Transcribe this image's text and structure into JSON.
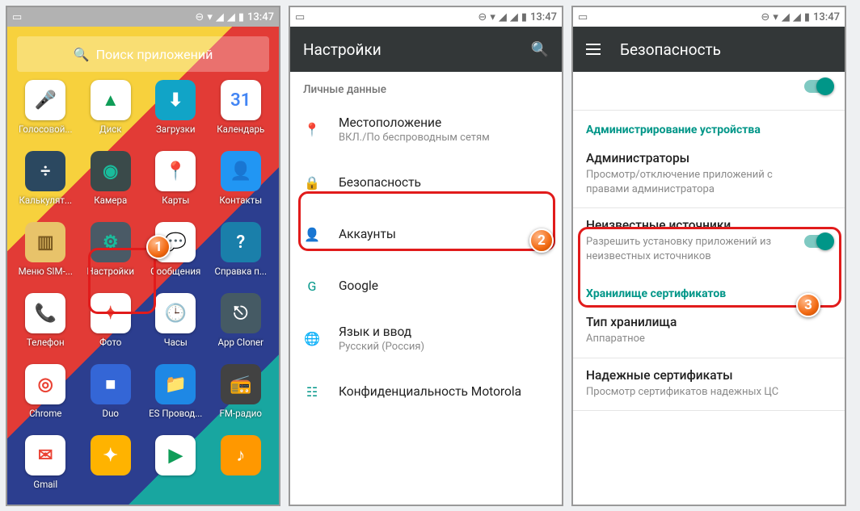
{
  "status": {
    "time": "13:47"
  },
  "drawer": {
    "search_placeholder": "Поиск приложений",
    "apps": [
      {
        "label": "Голосовой...",
        "bg": "#ffffff",
        "glyph": "🎤",
        "fg": "#4285f4"
      },
      {
        "label": "Диск",
        "bg": "#ffffff",
        "glyph": "▲",
        "fg": "#0f9d58"
      },
      {
        "label": "Загрузки",
        "bg": "#11a4c7",
        "glyph": "⬇",
        "fg": "#fff"
      },
      {
        "label": "Календарь",
        "bg": "#ffffff",
        "glyph": "31",
        "fg": "#4285f4"
      },
      {
        "label": "Калькулят...",
        "bg": "#2b4860",
        "glyph": "÷",
        "fg": "#fff"
      },
      {
        "label": "Камера",
        "bg": "#3a4a4a",
        "glyph": "◉",
        "fg": "#1abc9c"
      },
      {
        "label": "Карты",
        "bg": "#ffffff",
        "glyph": "📍",
        "fg": "#ea4335"
      },
      {
        "label": "Контакты",
        "bg": "#2196f3",
        "glyph": "👤",
        "fg": "#fff"
      },
      {
        "label": "Меню SIM-...",
        "bg": "#e8c36a",
        "glyph": "▥",
        "fg": "#7a5a20"
      },
      {
        "label": "Настройки",
        "bg": "#4a5a66",
        "glyph": "⚙",
        "fg": "#1abc9c"
      },
      {
        "label": "Сообщения",
        "bg": "#ffffff",
        "glyph": "💬",
        "fg": "#2196f3"
      },
      {
        "label": "Справка п...",
        "bg": "#1a7faa",
        "glyph": "?",
        "fg": "#fff"
      },
      {
        "label": "Телефон",
        "bg": "#ffffff",
        "glyph": "📞",
        "fg": "#2196f3"
      },
      {
        "label": "Фото",
        "bg": "#ffffff",
        "glyph": "✦",
        "fg": "#ea4335"
      },
      {
        "label": "Часы",
        "bg": "#ffffff",
        "glyph": "🕒",
        "fg": "#2196f3"
      },
      {
        "label": "App Cloner",
        "bg": "#455a64",
        "glyph": "⎋",
        "fg": "#fff"
      },
      {
        "label": "Chrome",
        "bg": "#ffffff",
        "glyph": "◎",
        "fg": "#ea4335"
      },
      {
        "label": "Duo",
        "bg": "#3466d6",
        "glyph": "■",
        "fg": "#fff"
      },
      {
        "label": "ES Провод...",
        "bg": "#1e88e5",
        "glyph": "📁",
        "fg": "#fff"
      },
      {
        "label": "FM-радио",
        "bg": "#424242",
        "glyph": "📻",
        "fg": "#ff9800"
      },
      {
        "label": "Gmail",
        "bg": "#ffffff",
        "glyph": "✉",
        "fg": "#ea4335"
      },
      {
        "label": "",
        "bg": "#ffb300",
        "glyph": "✦",
        "fg": "#fff"
      },
      {
        "label": "",
        "bg": "#ffffff",
        "glyph": "▶",
        "fg": "#0f9d58"
      },
      {
        "label": "",
        "bg": "#ff9800",
        "glyph": "♪",
        "fg": "#fff"
      }
    ]
  },
  "settings": {
    "title": "Настройки",
    "section": "Личные данные",
    "items": [
      {
        "title": "Местоположение",
        "sub": "ВКЛ./По беспроводным сетям",
        "icon": "📍"
      },
      {
        "title": "Безопасность",
        "sub": "",
        "icon": "🔒"
      },
      {
        "title": "Аккаунты",
        "sub": "",
        "icon": "👤"
      },
      {
        "title": "Google",
        "sub": "",
        "icon": "G"
      },
      {
        "title": "Язык и ввод",
        "sub": "Русский (Россия)",
        "icon": "🌐"
      },
      {
        "title": "Конфиденциальность Motorola",
        "sub": "",
        "icon": "☷"
      }
    ]
  },
  "security": {
    "title": "Безопасность",
    "section_admin": "Администрирование устройства",
    "admins": {
      "title": "Администраторы",
      "sub": "Просмотр/отключение приложений с правами администратора"
    },
    "unknown": {
      "title": "Неизвестные источники",
      "sub": "Разрешить установку приложений из неизвестных источников"
    },
    "section_cert": "Хранилище сертификатов",
    "storage": {
      "title": "Тип хранилища",
      "sub": "Аппаратное"
    },
    "trusted": {
      "title": "Надежные сертификаты",
      "sub": "Просмотр сертификатов надежных ЦС"
    }
  },
  "markers": {
    "m1": "1",
    "m2": "2",
    "m3": "3"
  }
}
